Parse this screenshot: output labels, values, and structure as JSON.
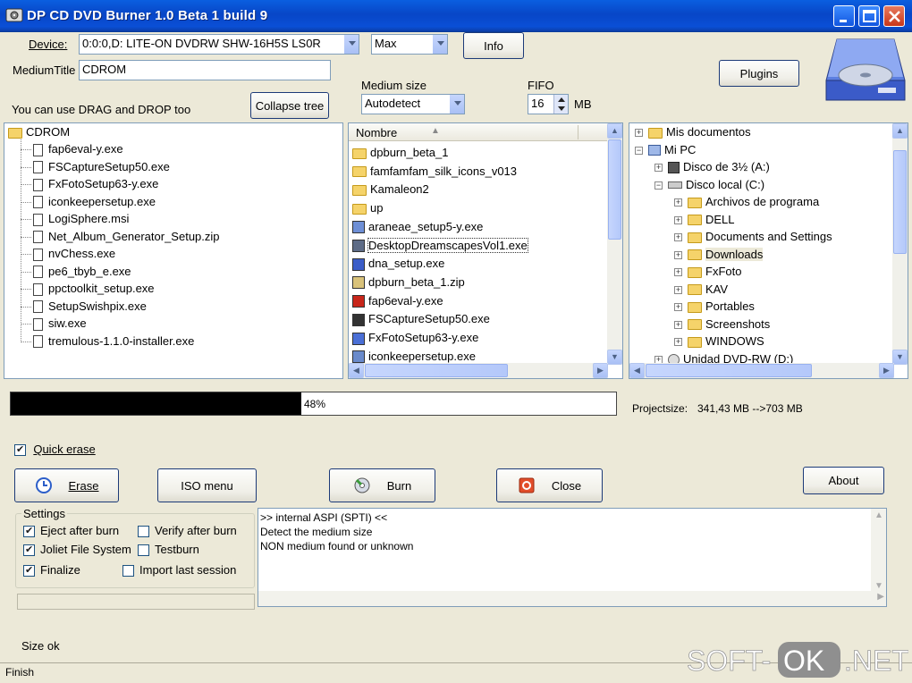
{
  "window": {
    "title": "DP CD DVD Burner 1.0  Beta 1 build 9"
  },
  "device": {
    "label": "Device:",
    "value": "0:0:0,D: LITE-ON DVDRW SHW-16H5S LS0R",
    "speed": "Max",
    "info_button": "Info"
  },
  "medium_title": {
    "label": "MediumTitle",
    "value": "CDROM"
  },
  "plugins_button": "Plugins",
  "drag_hint": "You can use DRAG and DROP too",
  "collapse_button": "Collapse tree",
  "medium_size": {
    "label": "Medium size",
    "value": "Autodetect"
  },
  "fifo": {
    "label": "FIFO",
    "value": "16",
    "unit": "MB"
  },
  "project_tree": {
    "root": "CDROM",
    "items": [
      "fap6eval-y.exe",
      "FSCaptureSetup50.exe",
      "FxFotoSetup63-y.exe",
      "iconkeepersetup.exe",
      "LogiSphere.msi",
      "Net_Album_Generator_Setup.zip",
      "nvChess.exe",
      "pe6_tbyb_e.exe",
      "ppctoolkit_setup.exe",
      "SetupSwishpix.exe",
      "siw.exe",
      "tremulous-1.1.0-installer.exe"
    ]
  },
  "file_list": {
    "column": "Nombre",
    "items": [
      "dpburn_beta_1",
      "famfamfam_silk_icons_v013",
      "Kamaleon2",
      "up",
      "araneae_setup5-y.exe",
      "DesktopDreamscapesVol1.exe",
      "dna_setup.exe",
      "dpburn_beta_1.zip",
      "fap6eval-y.exe",
      "FSCaptureSetup50.exe",
      "FxFotoSetup63-y.exe",
      "iconkeepersetup.exe"
    ]
  },
  "explorer_tree": {
    "items": [
      "Mis documentos",
      "Mi PC",
      "Disco de 3½ (A:)",
      "Disco local (C:)",
      "Archivos de programa",
      "DELL",
      "Documents and Settings",
      "Downloads",
      "FxFoto",
      "KAV",
      "Portables",
      "Screenshots",
      "WINDOWS",
      "Unidad DVD-RW (D:)"
    ]
  },
  "progress": {
    "percent": 0.48,
    "label": "48%"
  },
  "project_size": {
    "label": "Projectsize:",
    "value": "341,43 MB -->703 MB"
  },
  "quick_erase": {
    "label": "Quick erase",
    "checked": true
  },
  "buttons": {
    "erase": "Erase",
    "iso": "ISO menu",
    "burn": "Burn",
    "close": "Close",
    "about": "About"
  },
  "settings": {
    "label": "Settings",
    "eject": {
      "label": "Eject after burn",
      "checked": true
    },
    "verify": {
      "label": "Verify after burn",
      "checked": false
    },
    "joliet": {
      "label": "Joliet File System",
      "checked": true
    },
    "testburn": {
      "label": "Testburn",
      "checked": false
    },
    "finalize": {
      "label": "Finalize",
      "checked": true
    },
    "import": {
      "label": "Import last session",
      "checked": false
    }
  },
  "log": {
    "lines": [
      ">> internal ASPI (SPTI) <<",
      "Detect the medium size",
      "NON medium found or unknown"
    ]
  },
  "size_status": "Size ok",
  "statusbar": "Finish",
  "watermark": "SOFT-OK.NET",
  "colors": {
    "titlebar": "#0a4fd6",
    "progress_fill": "#000000",
    "window_bg": "#ece9d8"
  }
}
